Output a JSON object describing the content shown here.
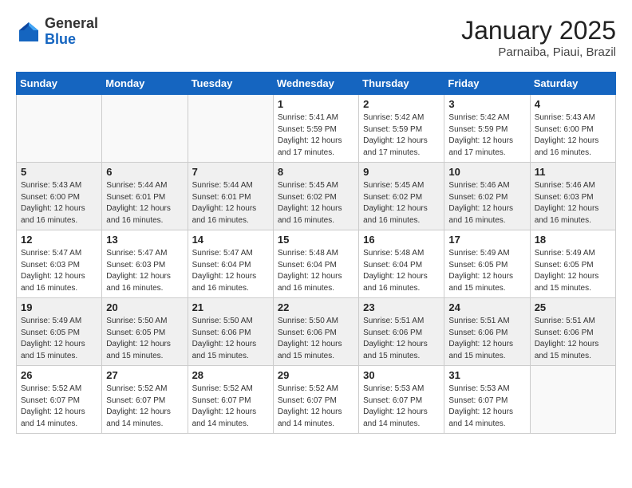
{
  "header": {
    "logo_general": "General",
    "logo_blue": "Blue",
    "month_title": "January 2025",
    "location": "Parnaiba, Piaui, Brazil"
  },
  "weekdays": [
    "Sunday",
    "Monday",
    "Tuesday",
    "Wednesday",
    "Thursday",
    "Friday",
    "Saturday"
  ],
  "weeks": [
    {
      "shaded": false,
      "days": [
        {
          "num": "",
          "info": ""
        },
        {
          "num": "",
          "info": ""
        },
        {
          "num": "",
          "info": ""
        },
        {
          "num": "1",
          "info": "Sunrise: 5:41 AM\nSunset: 5:59 PM\nDaylight: 12 hours and 17 minutes."
        },
        {
          "num": "2",
          "info": "Sunrise: 5:42 AM\nSunset: 5:59 PM\nDaylight: 12 hours and 17 minutes."
        },
        {
          "num": "3",
          "info": "Sunrise: 5:42 AM\nSunset: 5:59 PM\nDaylight: 12 hours and 17 minutes."
        },
        {
          "num": "4",
          "info": "Sunrise: 5:43 AM\nSunset: 6:00 PM\nDaylight: 12 hours and 16 minutes."
        }
      ]
    },
    {
      "shaded": true,
      "days": [
        {
          "num": "5",
          "info": "Sunrise: 5:43 AM\nSunset: 6:00 PM\nDaylight: 12 hours and 16 minutes."
        },
        {
          "num": "6",
          "info": "Sunrise: 5:44 AM\nSunset: 6:01 PM\nDaylight: 12 hours and 16 minutes."
        },
        {
          "num": "7",
          "info": "Sunrise: 5:44 AM\nSunset: 6:01 PM\nDaylight: 12 hours and 16 minutes."
        },
        {
          "num": "8",
          "info": "Sunrise: 5:45 AM\nSunset: 6:02 PM\nDaylight: 12 hours and 16 minutes."
        },
        {
          "num": "9",
          "info": "Sunrise: 5:45 AM\nSunset: 6:02 PM\nDaylight: 12 hours and 16 minutes."
        },
        {
          "num": "10",
          "info": "Sunrise: 5:46 AM\nSunset: 6:02 PM\nDaylight: 12 hours and 16 minutes."
        },
        {
          "num": "11",
          "info": "Sunrise: 5:46 AM\nSunset: 6:03 PM\nDaylight: 12 hours and 16 minutes."
        }
      ]
    },
    {
      "shaded": false,
      "days": [
        {
          "num": "12",
          "info": "Sunrise: 5:47 AM\nSunset: 6:03 PM\nDaylight: 12 hours and 16 minutes."
        },
        {
          "num": "13",
          "info": "Sunrise: 5:47 AM\nSunset: 6:03 PM\nDaylight: 12 hours and 16 minutes."
        },
        {
          "num": "14",
          "info": "Sunrise: 5:47 AM\nSunset: 6:04 PM\nDaylight: 12 hours and 16 minutes."
        },
        {
          "num": "15",
          "info": "Sunrise: 5:48 AM\nSunset: 6:04 PM\nDaylight: 12 hours and 16 minutes."
        },
        {
          "num": "16",
          "info": "Sunrise: 5:48 AM\nSunset: 6:04 PM\nDaylight: 12 hours and 16 minutes."
        },
        {
          "num": "17",
          "info": "Sunrise: 5:49 AM\nSunset: 6:05 PM\nDaylight: 12 hours and 15 minutes."
        },
        {
          "num": "18",
          "info": "Sunrise: 5:49 AM\nSunset: 6:05 PM\nDaylight: 12 hours and 15 minutes."
        }
      ]
    },
    {
      "shaded": true,
      "days": [
        {
          "num": "19",
          "info": "Sunrise: 5:49 AM\nSunset: 6:05 PM\nDaylight: 12 hours and 15 minutes."
        },
        {
          "num": "20",
          "info": "Sunrise: 5:50 AM\nSunset: 6:05 PM\nDaylight: 12 hours and 15 minutes."
        },
        {
          "num": "21",
          "info": "Sunrise: 5:50 AM\nSunset: 6:06 PM\nDaylight: 12 hours and 15 minutes."
        },
        {
          "num": "22",
          "info": "Sunrise: 5:50 AM\nSunset: 6:06 PM\nDaylight: 12 hours and 15 minutes."
        },
        {
          "num": "23",
          "info": "Sunrise: 5:51 AM\nSunset: 6:06 PM\nDaylight: 12 hours and 15 minutes."
        },
        {
          "num": "24",
          "info": "Sunrise: 5:51 AM\nSunset: 6:06 PM\nDaylight: 12 hours and 15 minutes."
        },
        {
          "num": "25",
          "info": "Sunrise: 5:51 AM\nSunset: 6:06 PM\nDaylight: 12 hours and 15 minutes."
        }
      ]
    },
    {
      "shaded": false,
      "days": [
        {
          "num": "26",
          "info": "Sunrise: 5:52 AM\nSunset: 6:07 PM\nDaylight: 12 hours and 14 minutes."
        },
        {
          "num": "27",
          "info": "Sunrise: 5:52 AM\nSunset: 6:07 PM\nDaylight: 12 hours and 14 minutes."
        },
        {
          "num": "28",
          "info": "Sunrise: 5:52 AM\nSunset: 6:07 PM\nDaylight: 12 hours and 14 minutes."
        },
        {
          "num": "29",
          "info": "Sunrise: 5:52 AM\nSunset: 6:07 PM\nDaylight: 12 hours and 14 minutes."
        },
        {
          "num": "30",
          "info": "Sunrise: 5:53 AM\nSunset: 6:07 PM\nDaylight: 12 hours and 14 minutes."
        },
        {
          "num": "31",
          "info": "Sunrise: 5:53 AM\nSunset: 6:07 PM\nDaylight: 12 hours and 14 minutes."
        },
        {
          "num": "",
          "info": ""
        }
      ]
    }
  ]
}
